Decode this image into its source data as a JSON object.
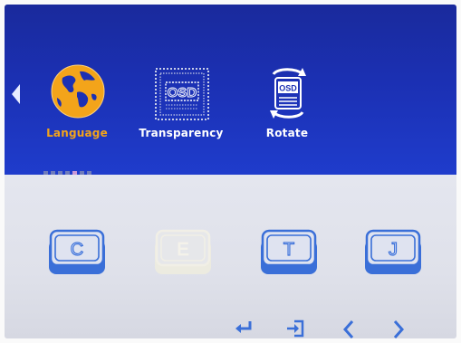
{
  "menu": {
    "items": [
      {
        "label": "Language",
        "icon": "globe-icon",
        "active": true
      },
      {
        "label": "Transparency",
        "icon": "osd-transparency-icon",
        "active": false
      },
      {
        "label": "Rotate",
        "icon": "osd-rotate-icon",
        "active": false
      }
    ],
    "page_indicator": {
      "count": 7,
      "active_index": 4
    }
  },
  "language_keys": [
    {
      "letter": "C",
      "enabled": true
    },
    {
      "letter": "E",
      "enabled": false
    },
    {
      "letter": "T",
      "enabled": true
    },
    {
      "letter": "J",
      "enabled": true
    }
  ],
  "nav_icons": [
    "enter-icon",
    "exit-icon",
    "left-icon",
    "right-icon"
  ],
  "colors": {
    "header_blue": "#1b30b3",
    "accent_orange": "#f3a41a",
    "key_blue": "#3a6fd8",
    "text_white": "#ffffff"
  }
}
